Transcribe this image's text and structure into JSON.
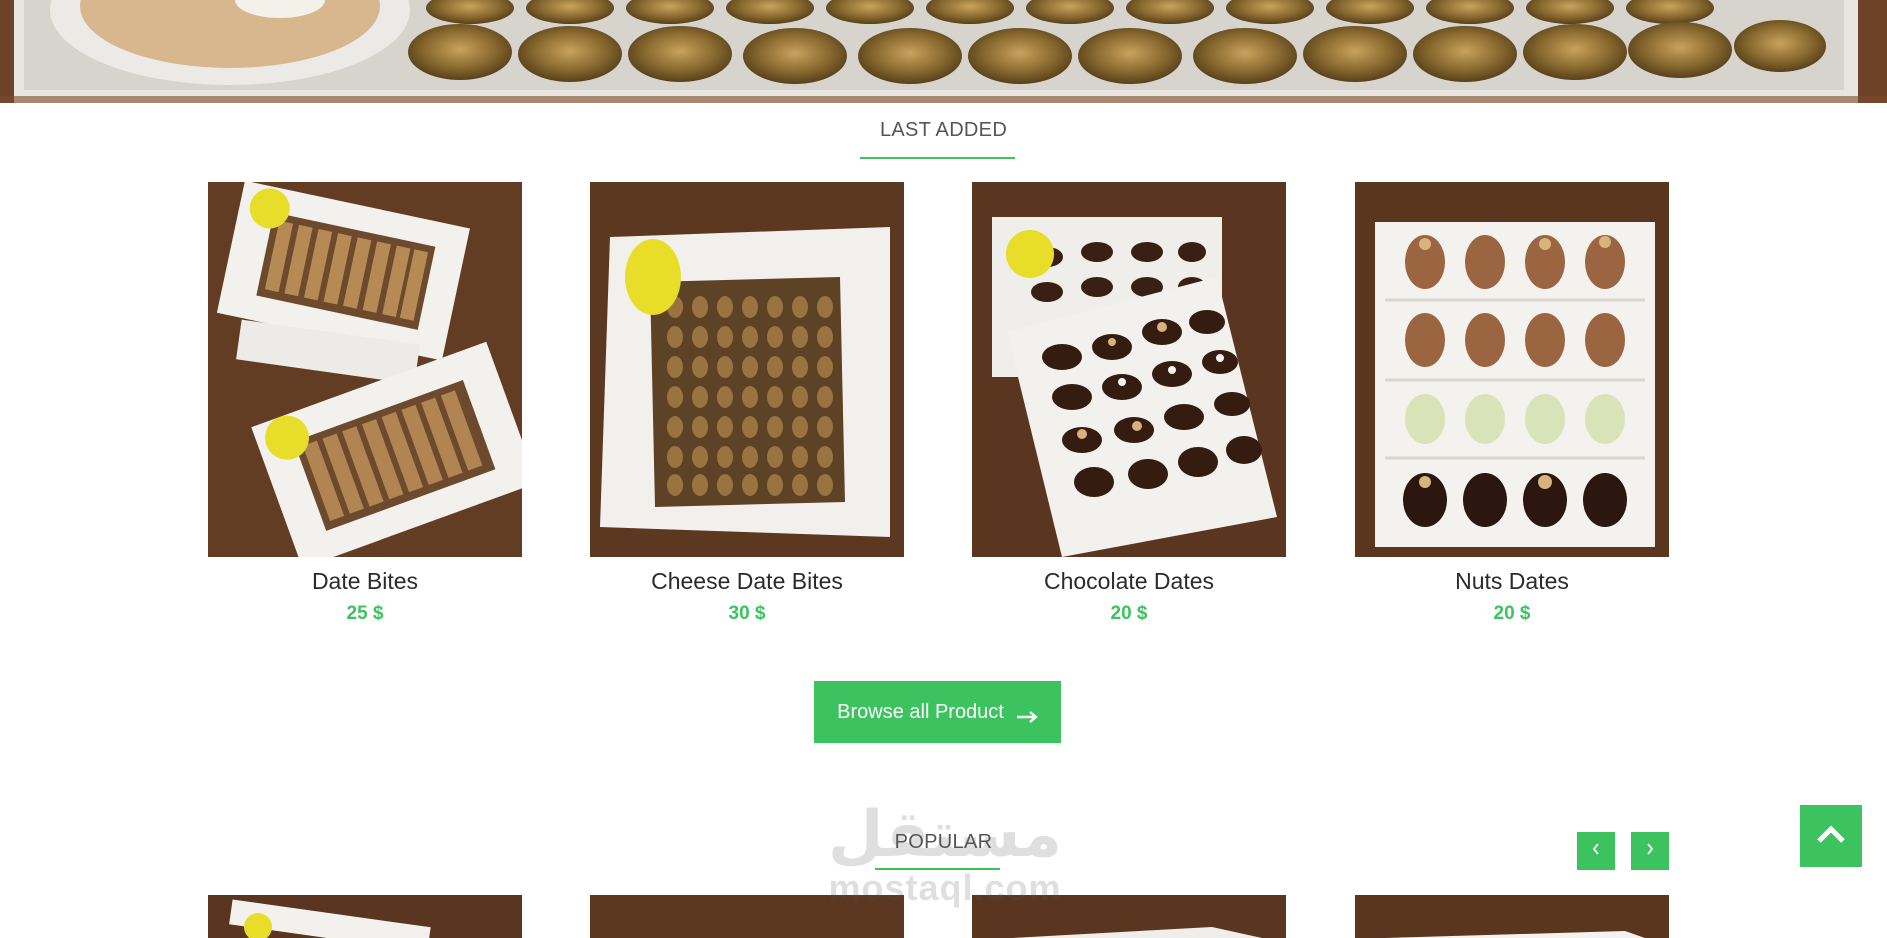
{
  "colors": {
    "accent": "#3cc35f",
    "heading_text": "#555555",
    "product_text": "#2b2b2b"
  },
  "last_added": {
    "title": "LAST ADDED",
    "products": [
      {
        "name": "Date Bites",
        "price": "25 $",
        "image": "boxes of date bites on wooden table"
      },
      {
        "name": "Cheese Date Bites",
        "price": "30 $",
        "image": "box of cheese date bites"
      },
      {
        "name": "Chocolate Dates",
        "price": "20 $",
        "image": "boxes of chocolate dates"
      },
      {
        "name": "Nuts Dates",
        "price": "20 $",
        "image": "box of nuts dates"
      }
    ]
  },
  "browse_button": {
    "label": "Browse all Product",
    "icon": "arrow-right-icon"
  },
  "popular": {
    "title": "POPULAR",
    "prev_icon": "chevron-left-icon",
    "next_icon": "chevron-right-icon"
  },
  "scroll_top_icon": "chevron-up-icon",
  "watermark": {
    "arabic": "مستقل",
    "latin": "mostaql.com"
  }
}
